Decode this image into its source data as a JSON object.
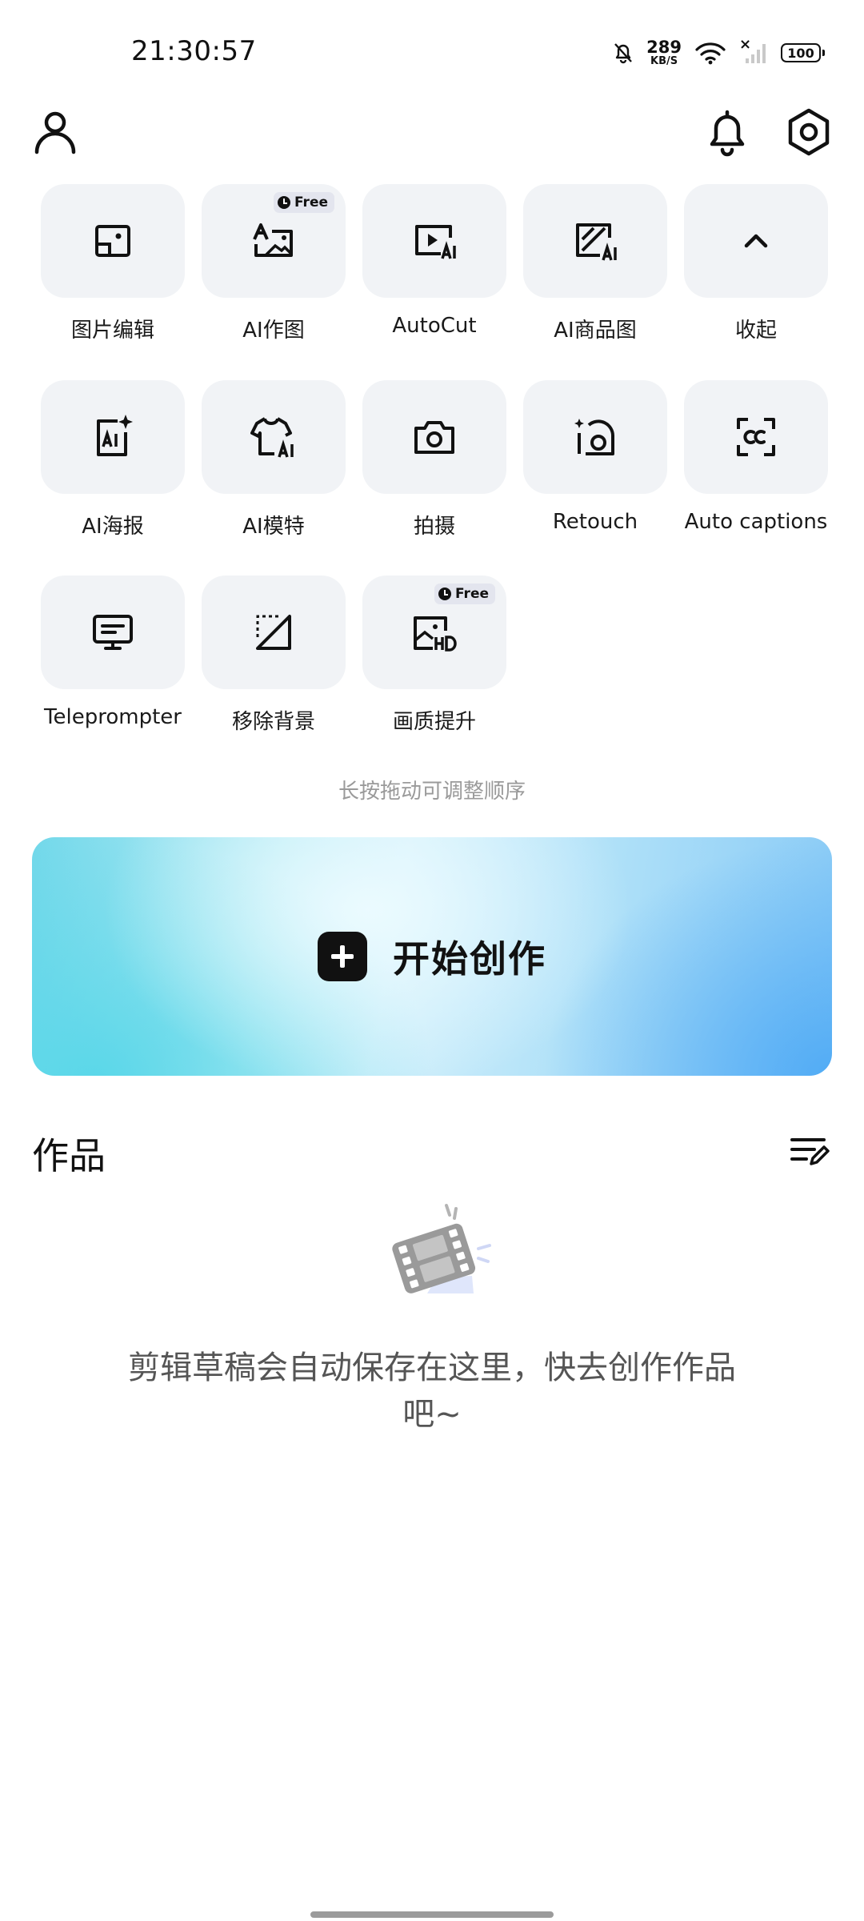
{
  "status_bar": {
    "time": "21:30:57",
    "net_speed_value": "289",
    "net_speed_unit": "KB/S",
    "signal_x": "×",
    "battery": "100"
  },
  "header": {
    "left_icon": "user-icon",
    "right_icons": [
      "bell-icon",
      "settings-icon"
    ]
  },
  "tools": {
    "items": [
      {
        "label": "图片编辑",
        "icon": "photo-edit-icon"
      },
      {
        "label": "AI作图",
        "icon": "ai-draw-icon",
        "badge": "Free"
      },
      {
        "label": "AutoCut",
        "icon": "autocut-icon"
      },
      {
        "label": "AI商品图",
        "icon": "ai-product-icon"
      },
      {
        "label": "收起",
        "icon": "chevron-up-icon"
      },
      {
        "label": "AI海报",
        "icon": "ai-poster-icon"
      },
      {
        "label": "AI模特",
        "icon": "ai-model-icon"
      },
      {
        "label": "拍摄",
        "icon": "camera-icon"
      },
      {
        "label": "Retouch",
        "icon": "retouch-icon"
      },
      {
        "label": "Auto captions",
        "icon": "captions-icon"
      },
      {
        "label": "Teleprompter",
        "icon": "teleprompter-icon"
      },
      {
        "label": "移除背景",
        "icon": "remove-bg-icon"
      },
      {
        "label": "画质提升",
        "icon": "hd-enhance-icon",
        "badge": "Free"
      }
    ],
    "hint": "长按拖动可调整顺序"
  },
  "create": {
    "label": "开始创作",
    "icon": "plus-icon"
  },
  "works": {
    "title": "作品",
    "action_icon": "manage-list-icon",
    "empty_icon": "film-icon",
    "empty_text": "剪辑草稿会自动保存在这里，快去创作作品吧~"
  },
  "colors": {
    "tile_bg": "#f1f3f6",
    "badge_bg": "#e3e5ee",
    "banner_start": "#72d8ea",
    "banner_end": "#4faaf5",
    "hint_text": "#9a9a9a"
  }
}
